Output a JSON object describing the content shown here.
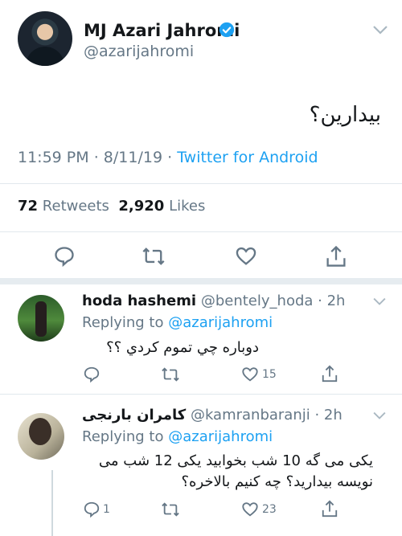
{
  "tweet": {
    "author_name": "MJ Azari Jahromi",
    "author_handle": "@azarijahromi",
    "text": "بیدارین؟",
    "time": "11:59 PM",
    "date": "8/11/19",
    "source": "Twitter for Android",
    "retweets": "72",
    "retweets_label": "Retweets",
    "likes": "2,920",
    "likes_label": "Likes"
  },
  "replies": [
    {
      "author_name": "hoda hashemi",
      "author_handle": "@bentely_hoda",
      "age": "2h",
      "replying_label": "Replying to",
      "replying_to": "@azarijahromi",
      "text": "دوباره چي تموم کردي ؟؟",
      "reply_count": "",
      "like_count": "15"
    },
    {
      "author_name": "کامران بارنجی",
      "author_handle": "@kamranbaranji",
      "age": "2h",
      "replying_label": "Replying to",
      "replying_to": "@azarijahromi",
      "text_line1": "یکی می گه 10 شب بخوابید یکی 12 شب می",
      "text_line2": "نویسه بیدارید؟ چه کنیم بالاخره؟",
      "reply_count": "1",
      "like_count": "23"
    }
  ],
  "icons": [
    "verified-badge-icon",
    "chevron-down-icon",
    "reply-icon",
    "retweet-icon",
    "like-icon",
    "share-icon"
  ],
  "colors": {
    "link": "#1da1f2",
    "muted": "#657786",
    "text": "#14171a",
    "divider": "#e1e8ed"
  }
}
